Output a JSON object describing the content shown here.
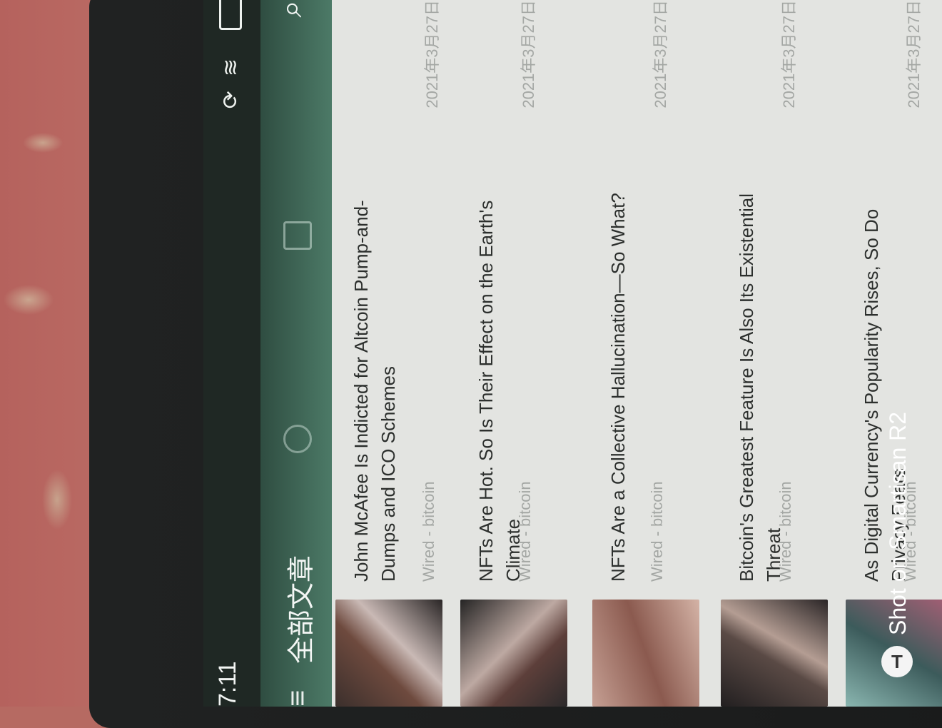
{
  "status": {
    "time": "7:11"
  },
  "appbar": {
    "title": "全部文章"
  },
  "articles": [
    {
      "title": "John McAfee Is Indicted for Altcoin Pump-and-Dumps and ICO Schemes",
      "source": "Wired - bitcoin",
      "date": "2021年3月27日"
    },
    {
      "title": "NFTs Are Hot. So Is Their Effect on the Earth's Climate",
      "source": "Wired - bitcoin",
      "date": "2021年3月27日"
    },
    {
      "title": "NFTs Are a Collective Hallucination—So What?",
      "source": "Wired - bitcoin",
      "date": "2021年3月27日"
    },
    {
      "title": "Bitcoin's Greatest Feature Is Also Its Existential Threat",
      "source": "Wired - bitcoin",
      "date": "2021年3月27日"
    },
    {
      "title": "As Digital Currency's Popularity Rises, So Do Privacy Fears",
      "source": "Wired - bitcoin",
      "date": "2021年3月27日"
    }
  ],
  "watermark": {
    "text": "Shot on Smartisan R2",
    "logo": "T"
  }
}
